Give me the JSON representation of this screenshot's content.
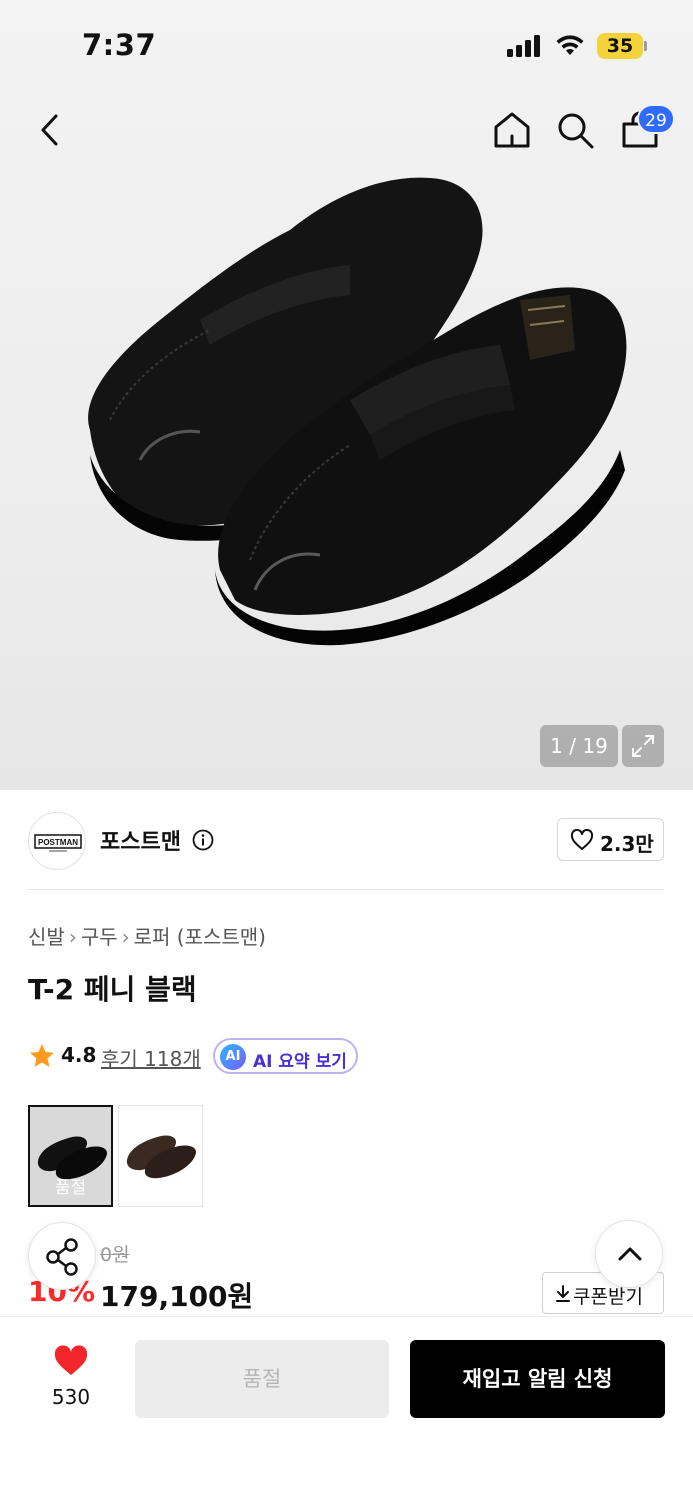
{
  "status_bar": {
    "time": "7:37",
    "battery": "35"
  },
  "header": {
    "back_icon": "chevron-left-icon",
    "home_icon": "home-icon",
    "search_icon": "search-icon",
    "cart_icon": "shopping-bag-icon",
    "cart_count": "29"
  },
  "gallery": {
    "counter": "1 / 19",
    "expand_icon": "expand-icon"
  },
  "brand": {
    "name": "포스트맨",
    "logo_text": "POSTMAN",
    "like_count": "2.3만"
  },
  "breadcrumb": [
    "신발",
    "구두",
    "로퍼 (포스트맨)"
  ],
  "product": {
    "title": "T-2 페니 블랙",
    "rating": "4.8",
    "review_link": "후기 118개",
    "ai_badge": "AI",
    "ai_label": "AI 요약 보기",
    "color_options": [
      {
        "color": "#1a1a1a",
        "tag": "품절",
        "selected": true
      },
      {
        "color": "#3a2a22",
        "tag": "",
        "selected": false
      }
    ],
    "original_price_visible": "0원",
    "discount_visible": "10%",
    "price": "179,100원",
    "coupon_label": "쿠폰받기"
  },
  "bottom_bar": {
    "wish_count": "530",
    "soldout_label": "품절",
    "restock_label": "재입고 알림 신청"
  },
  "colors": {
    "accent_blue": "#2f6bff",
    "discount_red": "#ff2a2a",
    "wish_red": "#f2262b",
    "battery_yellow": "#f4d23a",
    "ai_purple": "#4a2fd8"
  }
}
